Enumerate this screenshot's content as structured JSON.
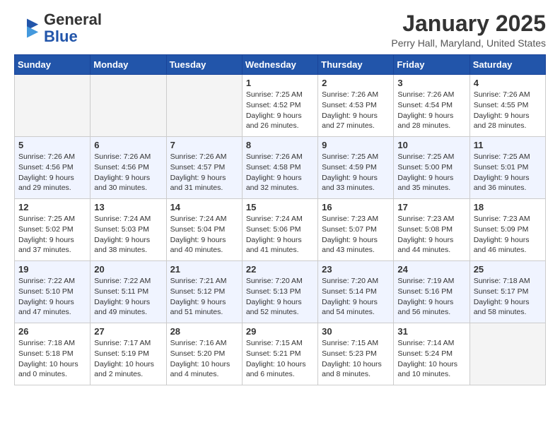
{
  "header": {
    "logo_general": "General",
    "logo_blue": "Blue",
    "month_title": "January 2025",
    "location": "Perry Hall, Maryland, United States"
  },
  "weekdays": [
    "Sunday",
    "Monday",
    "Tuesday",
    "Wednesday",
    "Thursday",
    "Friday",
    "Saturday"
  ],
  "weeks": [
    [
      {
        "day": "",
        "info": ""
      },
      {
        "day": "",
        "info": ""
      },
      {
        "day": "",
        "info": ""
      },
      {
        "day": "1",
        "info": "Sunrise: 7:25 AM\nSunset: 4:52 PM\nDaylight: 9 hours\nand 26 minutes."
      },
      {
        "day": "2",
        "info": "Sunrise: 7:26 AM\nSunset: 4:53 PM\nDaylight: 9 hours\nand 27 minutes."
      },
      {
        "day": "3",
        "info": "Sunrise: 7:26 AM\nSunset: 4:54 PM\nDaylight: 9 hours\nand 28 minutes."
      },
      {
        "day": "4",
        "info": "Sunrise: 7:26 AM\nSunset: 4:55 PM\nDaylight: 9 hours\nand 28 minutes."
      }
    ],
    [
      {
        "day": "5",
        "info": "Sunrise: 7:26 AM\nSunset: 4:56 PM\nDaylight: 9 hours\nand 29 minutes."
      },
      {
        "day": "6",
        "info": "Sunrise: 7:26 AM\nSunset: 4:56 PM\nDaylight: 9 hours\nand 30 minutes."
      },
      {
        "day": "7",
        "info": "Sunrise: 7:26 AM\nSunset: 4:57 PM\nDaylight: 9 hours\nand 31 minutes."
      },
      {
        "day": "8",
        "info": "Sunrise: 7:26 AM\nSunset: 4:58 PM\nDaylight: 9 hours\nand 32 minutes."
      },
      {
        "day": "9",
        "info": "Sunrise: 7:25 AM\nSunset: 4:59 PM\nDaylight: 9 hours\nand 33 minutes."
      },
      {
        "day": "10",
        "info": "Sunrise: 7:25 AM\nSunset: 5:00 PM\nDaylight: 9 hours\nand 35 minutes."
      },
      {
        "day": "11",
        "info": "Sunrise: 7:25 AM\nSunset: 5:01 PM\nDaylight: 9 hours\nand 36 minutes."
      }
    ],
    [
      {
        "day": "12",
        "info": "Sunrise: 7:25 AM\nSunset: 5:02 PM\nDaylight: 9 hours\nand 37 minutes."
      },
      {
        "day": "13",
        "info": "Sunrise: 7:24 AM\nSunset: 5:03 PM\nDaylight: 9 hours\nand 38 minutes."
      },
      {
        "day": "14",
        "info": "Sunrise: 7:24 AM\nSunset: 5:04 PM\nDaylight: 9 hours\nand 40 minutes."
      },
      {
        "day": "15",
        "info": "Sunrise: 7:24 AM\nSunset: 5:06 PM\nDaylight: 9 hours\nand 41 minutes."
      },
      {
        "day": "16",
        "info": "Sunrise: 7:23 AM\nSunset: 5:07 PM\nDaylight: 9 hours\nand 43 minutes."
      },
      {
        "day": "17",
        "info": "Sunrise: 7:23 AM\nSunset: 5:08 PM\nDaylight: 9 hours\nand 44 minutes."
      },
      {
        "day": "18",
        "info": "Sunrise: 7:23 AM\nSunset: 5:09 PM\nDaylight: 9 hours\nand 46 minutes."
      }
    ],
    [
      {
        "day": "19",
        "info": "Sunrise: 7:22 AM\nSunset: 5:10 PM\nDaylight: 9 hours\nand 47 minutes."
      },
      {
        "day": "20",
        "info": "Sunrise: 7:22 AM\nSunset: 5:11 PM\nDaylight: 9 hours\nand 49 minutes."
      },
      {
        "day": "21",
        "info": "Sunrise: 7:21 AM\nSunset: 5:12 PM\nDaylight: 9 hours\nand 51 minutes."
      },
      {
        "day": "22",
        "info": "Sunrise: 7:20 AM\nSunset: 5:13 PM\nDaylight: 9 hours\nand 52 minutes."
      },
      {
        "day": "23",
        "info": "Sunrise: 7:20 AM\nSunset: 5:14 PM\nDaylight: 9 hours\nand 54 minutes."
      },
      {
        "day": "24",
        "info": "Sunrise: 7:19 AM\nSunset: 5:16 PM\nDaylight: 9 hours\nand 56 minutes."
      },
      {
        "day": "25",
        "info": "Sunrise: 7:18 AM\nSunset: 5:17 PM\nDaylight: 9 hours\nand 58 minutes."
      }
    ],
    [
      {
        "day": "26",
        "info": "Sunrise: 7:18 AM\nSunset: 5:18 PM\nDaylight: 10 hours\nand 0 minutes."
      },
      {
        "day": "27",
        "info": "Sunrise: 7:17 AM\nSunset: 5:19 PM\nDaylight: 10 hours\nand 2 minutes."
      },
      {
        "day": "28",
        "info": "Sunrise: 7:16 AM\nSunset: 5:20 PM\nDaylight: 10 hours\nand 4 minutes."
      },
      {
        "day": "29",
        "info": "Sunrise: 7:15 AM\nSunset: 5:21 PM\nDaylight: 10 hours\nand 6 minutes."
      },
      {
        "day": "30",
        "info": "Sunrise: 7:15 AM\nSunset: 5:23 PM\nDaylight: 10 hours\nand 8 minutes."
      },
      {
        "day": "31",
        "info": "Sunrise: 7:14 AM\nSunset: 5:24 PM\nDaylight: 10 hours\nand 10 minutes."
      },
      {
        "day": "",
        "info": ""
      }
    ]
  ]
}
